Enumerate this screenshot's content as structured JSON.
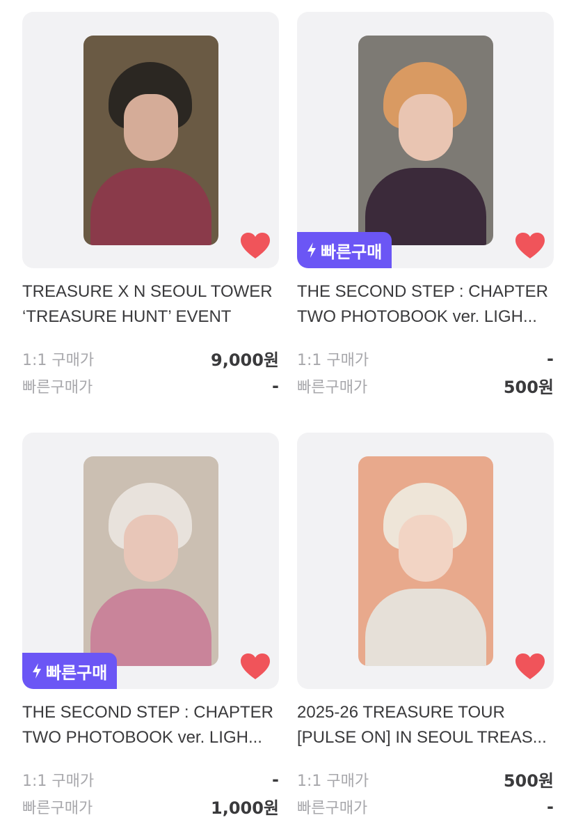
{
  "products": [
    {
      "title_line1": "TREASURE X N SEOUL TOWER",
      "title_line2": "‘TREASURE HUNT’ EVENT",
      "price_1to1_label": "1:1 구매가",
      "price_1to1": "9,000원",
      "price_quick_label": "빠른구매가",
      "price_quick": "-",
      "quick_badge": "",
      "favorited": true,
      "photo_colors": {
        "bg": "#6a5a44",
        "hair": "#2b2722",
        "face": "#d5ac98",
        "body": "#8a3a4a"
      }
    },
    {
      "title_line1": "THE SECOND STEP : CHAPTER",
      "title_line2": "TWO PHOTOBOOK ver. LIGH...",
      "price_1to1_label": "1:1 구매가",
      "price_1to1": "-",
      "price_quick_label": "빠른구매가",
      "price_quick": "500원",
      "quick_badge": "빠른구매",
      "favorited": true,
      "photo_colors": {
        "bg": "#7d7a74",
        "hair": "#d99a62",
        "face": "#e9c5b2",
        "body": "#3b2a3a"
      }
    },
    {
      "title_line1": "THE SECOND STEP : CHAPTER",
      "title_line2": "TWO PHOTOBOOK ver. LIGH...",
      "price_1to1_label": "1:1 구매가",
      "price_1to1": "-",
      "price_quick_label": "빠른구매가",
      "price_quick": "1,000원",
      "quick_badge": "빠른구매",
      "favorited": true,
      "photo_colors": {
        "bg": "#cbbfb2",
        "hair": "#e8e2dc",
        "face": "#e8c6b8",
        "body": "#c9849a"
      }
    },
    {
      "title_line1": "2025-26 TREASURE TOUR",
      "title_line2": "[PULSE ON] IN SEOUL TREAS...",
      "price_1to1_label": "1:1 구매가",
      "price_1to1": "500원",
      "price_quick_label": "빠른구매가",
      "price_quick": "-",
      "quick_badge": "",
      "favorited": true,
      "photo_colors": {
        "bg": "#e8a98c",
        "hair": "#eee5d8",
        "face": "#f2d4c4",
        "body": "#e6e0d8"
      }
    }
  ],
  "colors": {
    "heart": "#f0545a",
    "badge": "#6b56f5",
    "card_bg": "#f2f2f4"
  },
  "icons": {
    "favorite": "heart-icon",
    "quick": "lightning-icon"
  }
}
